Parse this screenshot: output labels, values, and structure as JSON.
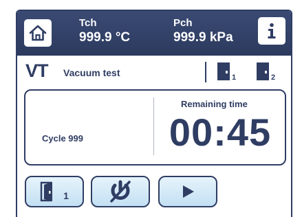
{
  "header": {
    "tch_label": "Tch",
    "tch_value": "999.9 °C",
    "pch_label": "Pch",
    "pch_value": "999.9 kPa",
    "home_icon": "home-icon",
    "info_icon": "info-icon"
  },
  "mode": {
    "code": "VT",
    "name": "Vacuum test",
    "door1_label": "1",
    "door2_label": "2"
  },
  "cycle": {
    "label": "Cycle 999",
    "remaining_label": "Remaining time",
    "remaining_value": "00:45"
  },
  "buttons": {
    "door_label": "1",
    "door_icon": "door-open-icon",
    "cancel_icon": "cancel-cycle-icon",
    "start_icon": "play-icon"
  },
  "colors": {
    "primary": "#2f3d63",
    "button_bg": "#d6ebf8"
  }
}
